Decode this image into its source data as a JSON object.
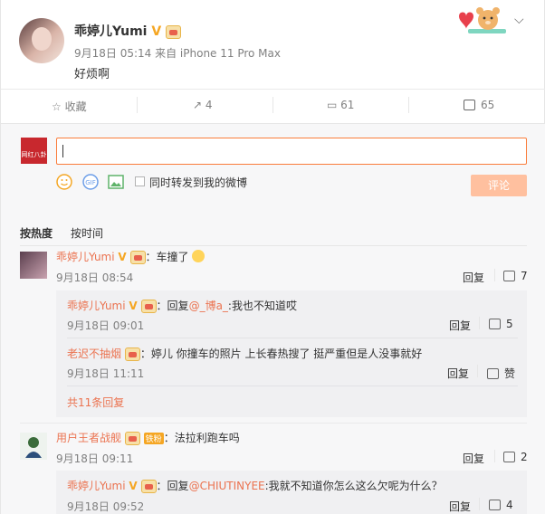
{
  "post": {
    "author": "乖婷儿Yumi",
    "verified": "V",
    "meta": "9月18日 05:14 来自 iPhone 11 Pro Max",
    "text": "好烦啊"
  },
  "actions": {
    "favorite": "收藏",
    "repost": "4",
    "comment": "61",
    "like": "65"
  },
  "composer": {
    "avatar_text": "网红八卦",
    "repost_label": "同时转发到我的微博",
    "submit": "评论"
  },
  "tabs": {
    "hot": "按热度",
    "time": "按时间"
  },
  "comments": [
    {
      "user": "乖婷儿Yumi",
      "verified": "V",
      "text": "：车撞了",
      "time": "9月18日 08:54",
      "reply": "回复",
      "likes": "7",
      "replies": [
        {
          "user": "乖婷儿Yumi",
          "verified": "V",
          "prefix": "：回复",
          "mention": "@_博a_",
          "text": ":我也不知道哎",
          "time": "9月18日 09:01",
          "reply": "回复",
          "likes": "5"
        },
        {
          "user": "老迟不抽烟",
          "text": "：婷儿 你撞车的照片 上长春热搜了 挺严重但是人没事就好",
          "time": "9月18日 11:11",
          "reply": "回复",
          "likes": "赞"
        }
      ],
      "more": "共11条回复"
    },
    {
      "user": "用户王者战舰",
      "badge": "铁粉",
      "text": "：法拉利跑车吗",
      "time": "9月18日 09:11",
      "reply": "回复",
      "likes": "2",
      "replies": [
        {
          "user": "乖婷儿Yumi",
          "verified": "V",
          "prefix": "：回复",
          "mention": "@CHIUTINYEE",
          "text": ":我就不知道你怎么这么欠呢为什么？",
          "time": "9月18日 09:52",
          "reply": "回复",
          "likes": "4"
        }
      ]
    }
  ],
  "colors": {
    "accent": "#eb7350",
    "verified": "#f5a623",
    "submit_disabled": "#ffc09f"
  }
}
